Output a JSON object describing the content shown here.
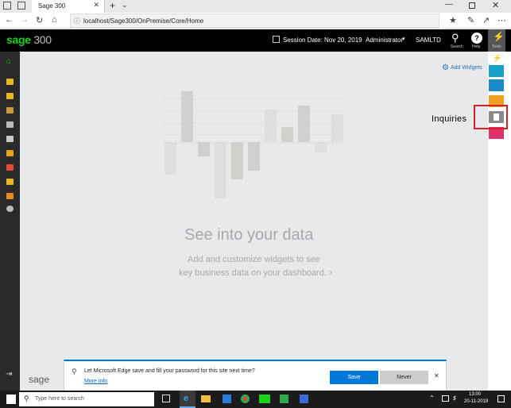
{
  "browser": {
    "tab_title": "Sage 300",
    "url": "localhost/Sage300/OnPremise/Core/Home"
  },
  "header": {
    "logo_main": "sage",
    "logo_num": "300",
    "session_date": "Session Date:  Nov 20, 2019",
    "user": "Administrator",
    "company": "SAMLTD",
    "search_label": "Search",
    "help_label": "Help",
    "tools_label": "Tools"
  },
  "main": {
    "add_widgets": "Add Widgets",
    "headline": "See into your data",
    "subtitle_1": "Add and customize widgets to see",
    "subtitle_2": "key business data on your dashboard.",
    "footer_logo": "sage"
  },
  "annotation": {
    "label": "Inquiries",
    "color": "#d62027"
  },
  "prompt": {
    "question": "Let Microsoft Edge save and fill your password for this site next time?",
    "more_info": "More info",
    "save": "Save",
    "never": "Never"
  },
  "taskbar": {
    "search_placeholder": "Type here to search",
    "time": "13:00",
    "date": "20-11-2019"
  },
  "colors": {
    "accent": "#19d419",
    "edge_blue": "#0078d7"
  }
}
